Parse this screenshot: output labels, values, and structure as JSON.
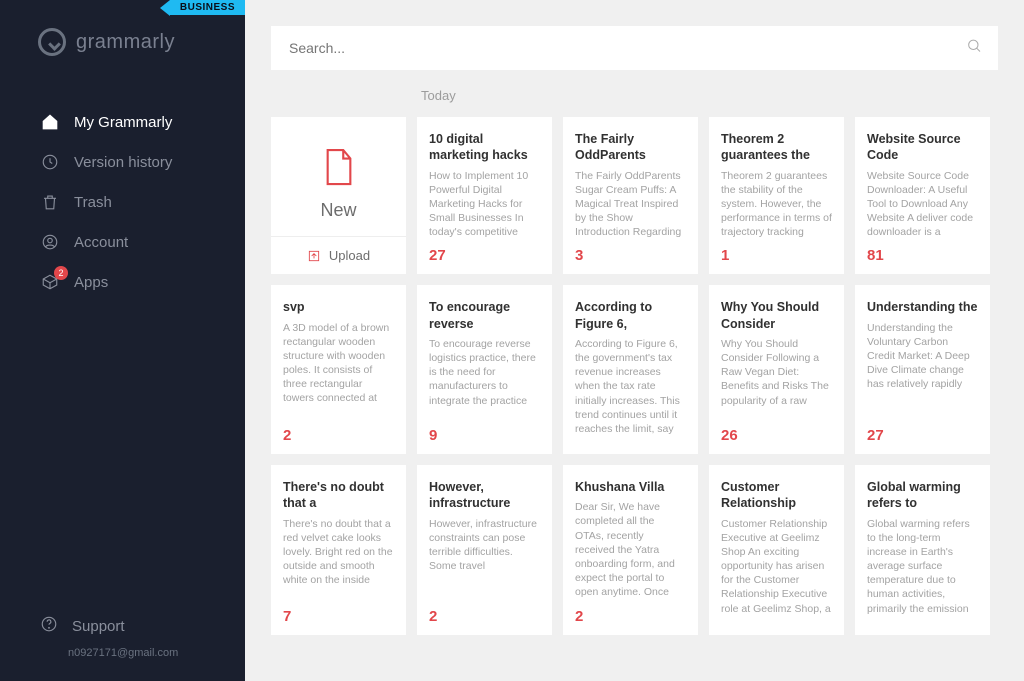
{
  "badge": "BUSINESS",
  "brand": "grammarly",
  "nav": {
    "items": [
      {
        "label": "My Grammarly",
        "icon": "home-icon",
        "active": true
      },
      {
        "label": "Version history",
        "icon": "history-icon"
      },
      {
        "label": "Trash",
        "icon": "trash-icon"
      },
      {
        "label": "Account",
        "icon": "account-icon"
      },
      {
        "label": "Apps",
        "icon": "apps-icon",
        "badge": "2"
      }
    ]
  },
  "support": {
    "label": "Support",
    "email": "n0927171@gmail.com"
  },
  "search": {
    "placeholder": "Search..."
  },
  "section": "Today",
  "new_card": {
    "label": "New",
    "upload": "Upload"
  },
  "docs": [
    {
      "title": "10 digital marketing hacks",
      "body": "How to Implement 10 Powerful Digital Marketing Hacks for Small Businesses In today's competitive",
      "count": "27"
    },
    {
      "title": "The Fairly OddParents",
      "body": "The Fairly OddParents Sugar Cream Puffs: A Magical Treat Inspired by the Show Introduction Regarding",
      "count": "3"
    },
    {
      "title": "Theorem 2 guarantees the",
      "body": "Theorem 2 guarantees the stability of the system. However, the performance in terms of trajectory tracking",
      "count": "1"
    },
    {
      "title": "Website Source Code",
      "body": "Website Source Code Downloader: A Useful Tool to Download Any Website A deliver code downloader is a",
      "count": "81"
    },
    {
      "title": "svp",
      "body": "A 3D model of a brown rectangular wooden structure with wooden poles. It consists of three rectangular towers connected at",
      "count": "2"
    },
    {
      "title": "To encourage reverse",
      "body": "To encourage reverse logistics practice, there is the need for manufacturers to integrate the practice",
      "count": "9"
    },
    {
      "title": "According to Figure 6,",
      "body": "According to Figure 6, the government's tax revenue increases when the tax rate initially increases. This trend continues until it reaches the limit, say",
      "count": ""
    },
    {
      "title": "Why You Should Consider",
      "body": "Why You Should Consider Following a Raw Vegan Diet: Benefits and Risks The popularity of a raw",
      "count": "26"
    },
    {
      "title": "Understanding the",
      "body": "Understanding the Voluntary Carbon Credit Market: A Deep Dive Climate change has relatively rapidly",
      "count": "27"
    },
    {
      "title": "There's no doubt that a",
      "body": "There's no doubt that a red velvet cake looks lovely. Bright red on the outside and smooth white on the inside",
      "count": "7"
    },
    {
      "title": "However, infrastructure",
      "body": "However, infrastructure constraints can pose terrible difficulties. Some travel",
      "count": "2"
    },
    {
      "title": "Khushana Villa",
      "body": "Dear Sir, We have completed all the OTAs, recently received the Yatra onboarding form, and expect the portal to open anytime. Once",
      "count": "2"
    },
    {
      "title": "Customer Relationship",
      "body": "Customer Relationship Executive at Geelimz Shop An exciting opportunity has arisen for the Customer Relationship Executive role at Geelimz Shop, a",
      "count": ""
    },
    {
      "title": "Global warming refers to",
      "body": "Global warming refers to the long-term increase in Earth's average surface temperature due to human activities, primarily the emission",
      "count": ""
    }
  ]
}
